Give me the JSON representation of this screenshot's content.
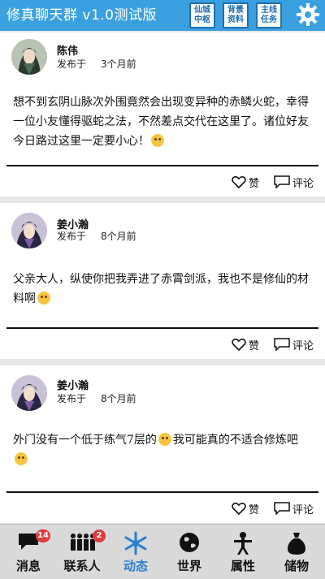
{
  "header": {
    "title": "修真聊天群 v1.0测试版",
    "buttons": [
      {
        "label": "仙城中枢"
      },
      {
        "label": "背景资料"
      },
      {
        "label": "主线任务"
      }
    ],
    "settings_icon": "gear-icon"
  },
  "posts": [
    {
      "author": "陈伟",
      "posted_prefix": "发布于",
      "time": "3个月前",
      "content_before": "想不到玄阴山脉次外围竟然会出现变异种的赤鳞火蛇，幸得一位小友懂得驱蛇之法，不然差点交代在这里了。诸位好友今日路过这里一定要小心！",
      "content_after": "",
      "emoji": "smile",
      "like_label": "赞",
      "comment_label": "评论"
    },
    {
      "author": "姜小瀚",
      "posted_prefix": "发布于",
      "time": "8个月前",
      "content_before": "父亲大人，纵使你把我弄进了赤霄剑派，我也不是修仙的材料啊",
      "content_after": "",
      "emoji": "cry",
      "like_label": "赞",
      "comment_label": "评论"
    },
    {
      "author": "姜小瀚",
      "posted_prefix": "发布于",
      "time": "8个月前",
      "content_before": "外门没有一个低于练气7层的",
      "content_middle": "我可能真的不适合修炼吧",
      "content_after": "",
      "emoji": "sad",
      "like_label": "赞",
      "comment_label": "评论"
    }
  ],
  "nav": [
    {
      "label": "消息",
      "icon": "chat-bubble-icon",
      "badge": "14",
      "active": false
    },
    {
      "label": "联系人",
      "icon": "people-icon",
      "badge": "2",
      "active": false
    },
    {
      "label": "动态",
      "icon": "feed-snowflake-icon",
      "badge": "",
      "active": true
    },
    {
      "label": "世界",
      "icon": "globe-icon",
      "badge": "",
      "active": false
    },
    {
      "label": "属性",
      "icon": "person-icon",
      "badge": "",
      "active": false
    },
    {
      "label": "储物",
      "icon": "bag-icon",
      "badge": "",
      "active": false
    }
  ],
  "colors": {
    "header_bg": "#3aa0e0",
    "active_nav": "#2a7fd0",
    "badge": "#e23b3b"
  }
}
